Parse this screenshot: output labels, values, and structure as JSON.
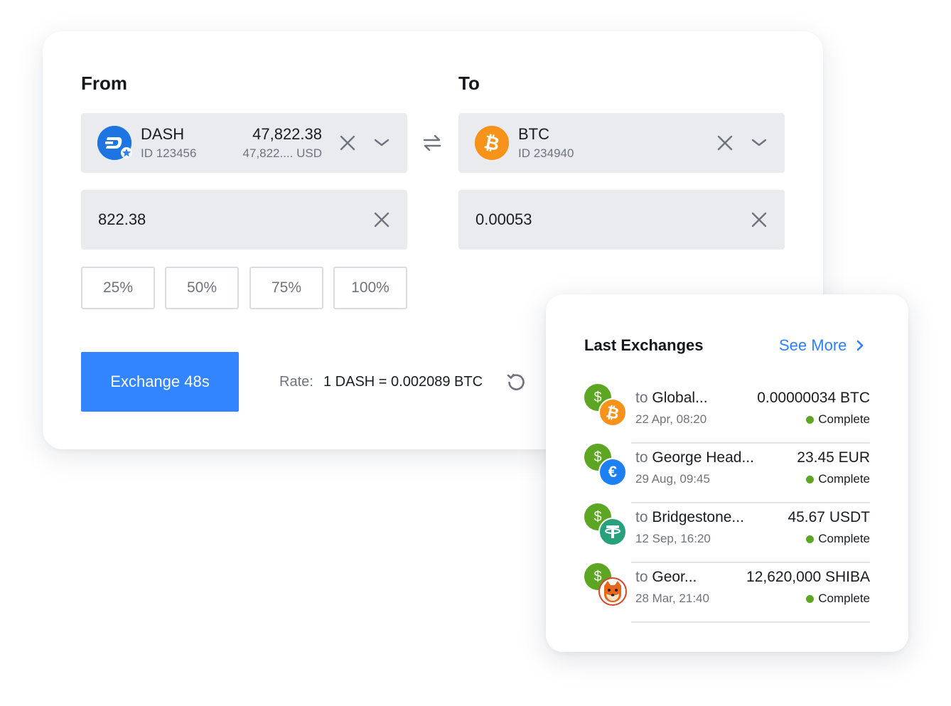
{
  "exchange": {
    "from_label": "From",
    "to_label": "To",
    "from": {
      "coin": "DASH",
      "id": "ID 123456",
      "balance": "47,822.38",
      "balance_usd": "47,822.... USD",
      "amount": "822.38",
      "icon": "dash-icon",
      "color": "#1c75e0"
    },
    "to": {
      "coin": "BTC",
      "id": "ID 234940",
      "amount": "0.00053",
      "icon": "bitcoin-icon",
      "color": "#f7931a"
    },
    "percent_options": [
      "25%",
      "50%",
      "75%",
      "100%"
    ],
    "exchange_button": "Exchange 48s",
    "rate_label": "Rate:",
    "rate_value": "1 DASH = 0.002089 BTC",
    "accent_color": "#3385ff"
  },
  "last_exchanges": {
    "title": "Last Exchanges",
    "see_more": "See More",
    "items": [
      {
        "to_prefix": "to",
        "name": "Global...",
        "date": "22 Apr, 08:20",
        "amount": "0.00000034 BTC",
        "status": "Complete",
        "currency_icon": "bitcoin-icon",
        "currency_color": "#f7931a"
      },
      {
        "to_prefix": "to",
        "name": "George Head...",
        "date": "29 Aug, 09:45",
        "amount": "23.45 EUR",
        "status": "Complete",
        "currency_icon": "euro-icon",
        "currency_color": "#1c7ff2"
      },
      {
        "to_prefix": "to",
        "name": "Bridgestone...",
        "date": "12 Sep, 16:20",
        "amount": "45.67 USDT",
        "status": "Complete",
        "currency_icon": "tether-icon",
        "currency_color": "#26a17b"
      },
      {
        "to_prefix": "to",
        "name": "Geor...",
        "date": "28 Mar, 21:40",
        "amount": "12,620,000 SHIBA",
        "status": "Complete",
        "currency_icon": "shiba-icon",
        "currency_color": "#e8651c"
      }
    ],
    "status_color": "#5ca623",
    "link_color": "#2f80ff"
  }
}
